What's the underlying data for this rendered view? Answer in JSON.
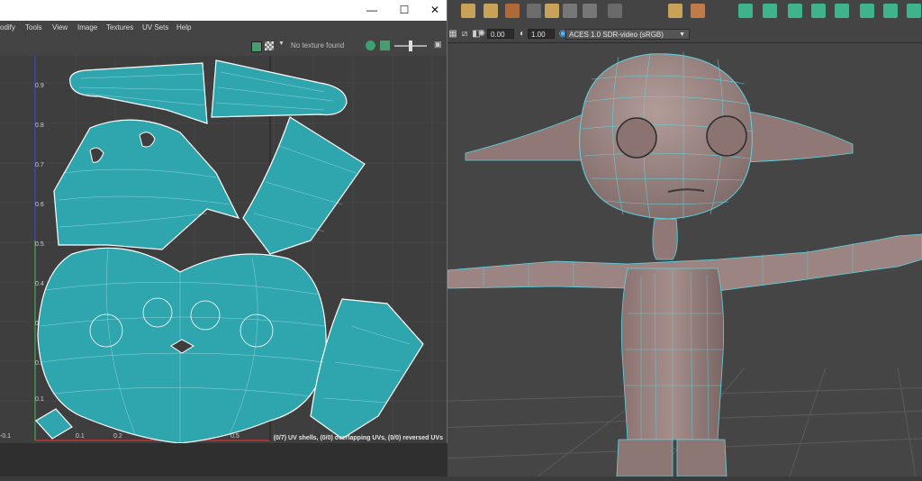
{
  "uv_editor": {
    "menus": [
      "odify",
      "Tools",
      "View",
      "Image",
      "Textures",
      "UV Sets",
      "Help"
    ],
    "window_controls": {
      "minimize": "—",
      "maximize": "☐",
      "close": "✕"
    },
    "texture_status": "No texture found",
    "status_text": "(0/7) UV shells, (0/0) overlapping UVs, (0/0) reversed UVs",
    "v_ticks": [
      "0.9",
      "0.8",
      "0.7",
      "0.6",
      "0.5",
      "0.4",
      "0.3",
      "0.2",
      "0.1"
    ],
    "u_ticks": [
      "0.1",
      "0.2",
      "0.5"
    ],
    "u_left_label": "-0.1"
  },
  "viewport": {
    "exposure_value": "0.00",
    "gamma_value": "1.00",
    "colorspace_label": "ACES 1.0 SDR-video (sRGB)",
    "colors": {
      "mesh": "#9b8481",
      "wire": "#5fd4e0",
      "background": "#454545"
    }
  }
}
